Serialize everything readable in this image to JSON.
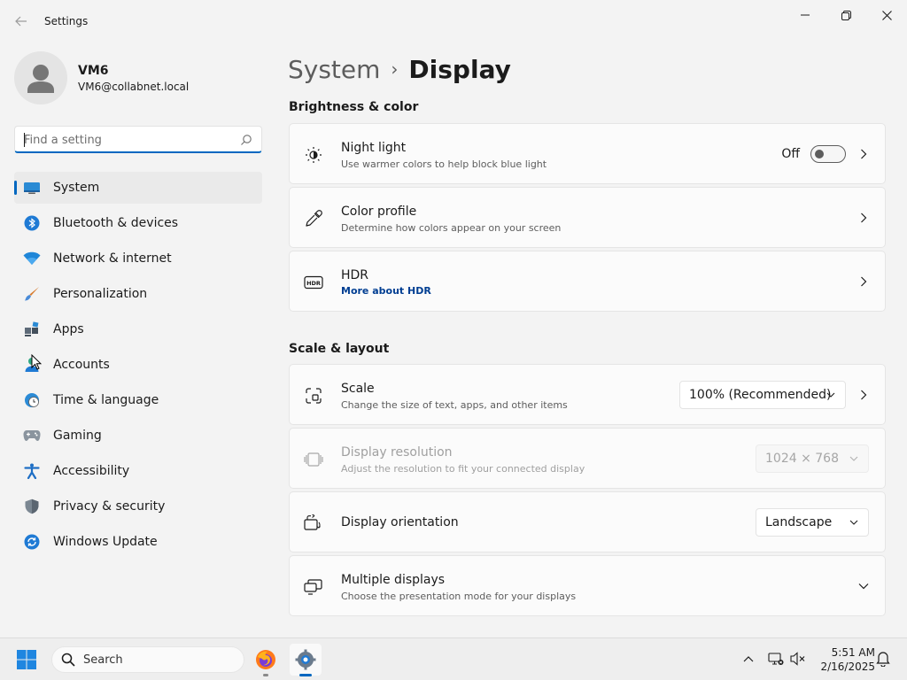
{
  "window": {
    "title": "Settings",
    "controls": {
      "minimize": "minimize",
      "maximize": "maximize",
      "close": "close"
    }
  },
  "user": {
    "name": "VM6",
    "email": "VM6@collabnet.local"
  },
  "search": {
    "placeholder": "Find a setting",
    "value": ""
  },
  "sidebar": {
    "items": [
      {
        "label": "System",
        "icon": "system-icon",
        "active": true
      },
      {
        "label": "Bluetooth & devices",
        "icon": "bluetooth-icon"
      },
      {
        "label": "Network & internet",
        "icon": "wifi-icon"
      },
      {
        "label": "Personalization",
        "icon": "brush-icon"
      },
      {
        "label": "Apps",
        "icon": "apps-icon"
      },
      {
        "label": "Accounts",
        "icon": "accounts-icon"
      },
      {
        "label": "Time & language",
        "icon": "globe-clock-icon"
      },
      {
        "label": "Gaming",
        "icon": "gamepad-icon"
      },
      {
        "label": "Accessibility",
        "icon": "accessibility-icon"
      },
      {
        "label": "Privacy & security",
        "icon": "shield-icon"
      },
      {
        "label": "Windows Update",
        "icon": "update-icon"
      }
    ]
  },
  "breadcrumb": {
    "parent": "System",
    "separator": "›",
    "current": "Display"
  },
  "sections": {
    "brightness": {
      "title": "Brightness & color",
      "night_light": {
        "title": "Night light",
        "subtitle": "Use warmer colors to help block blue light",
        "toggle_state": "Off",
        "toggle_on": false
      },
      "color_profile": {
        "title": "Color profile",
        "subtitle": "Determine how colors appear on your screen"
      },
      "hdr": {
        "title": "HDR",
        "link": "More about HDR",
        "icon_text": "HDR"
      }
    },
    "scale_layout": {
      "title": "Scale & layout",
      "scale": {
        "title": "Scale",
        "subtitle": "Change the size of text, apps, and other items",
        "value": "100% (Recommended)"
      },
      "resolution": {
        "title": "Display resolution",
        "subtitle": "Adjust the resolution to fit your connected display",
        "value": "1024 × 768",
        "disabled": true
      },
      "orientation": {
        "title": "Display orientation",
        "value": "Landscape"
      },
      "multiple": {
        "title": "Multiple displays",
        "subtitle": "Choose the presentation mode for your displays"
      }
    }
  },
  "taskbar": {
    "search_label": "Search",
    "apps": [
      "firefox-icon",
      "settings-icon"
    ],
    "time": "5:51 AM",
    "date": "2/16/2025"
  },
  "colors": {
    "accent": "#0067c0",
    "link": "#003e92",
    "background": "#f3f3f3",
    "card": "#fbfbfb"
  }
}
